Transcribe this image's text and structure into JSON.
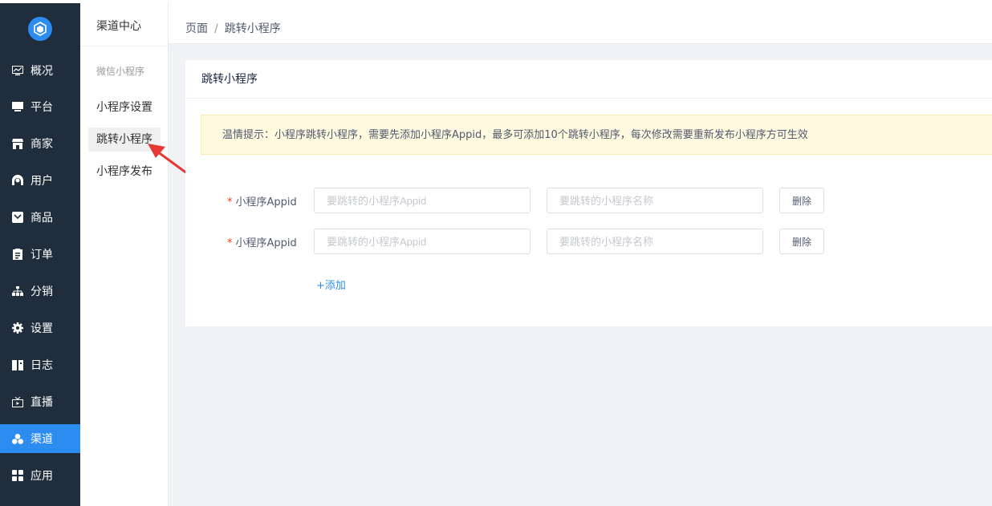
{
  "sidebar": {
    "logo_icon": "box-logo-icon",
    "items": [
      {
        "label": "概况",
        "icon": "chart-icon",
        "active": false
      },
      {
        "label": "平台",
        "icon": "monitor-icon",
        "active": false
      },
      {
        "label": "商家",
        "icon": "store-icon",
        "active": false
      },
      {
        "label": "用户",
        "icon": "user-icon",
        "active": false
      },
      {
        "label": "商品",
        "icon": "goods-icon",
        "active": false
      },
      {
        "label": "订单",
        "icon": "order-icon",
        "active": false
      },
      {
        "label": "分销",
        "icon": "org-tree-icon",
        "active": false
      },
      {
        "label": "设置",
        "icon": "gear-icon",
        "active": false
      },
      {
        "label": "日志",
        "icon": "book-icon",
        "active": false
      },
      {
        "label": "直播",
        "icon": "tv-icon",
        "active": false
      },
      {
        "label": "渠道",
        "icon": "channel-icon",
        "active": true
      },
      {
        "label": "应用",
        "icon": "grid-icon",
        "active": false
      }
    ],
    "accent": "#2d8cf0",
    "background": "#1f2d3d"
  },
  "submenu": {
    "title": "渠道中心",
    "group_label": "微信小程序",
    "items": [
      {
        "label": "小程序设置",
        "active": false
      },
      {
        "label": "跳转小程序",
        "active": true
      },
      {
        "label": "小程序发布",
        "active": false
      }
    ]
  },
  "breadcrumb": {
    "root": "页面",
    "separator": "/",
    "current": "跳转小程序"
  },
  "card": {
    "title": "跳转小程序",
    "notice": "温情提示：小程序跳转小程序，需要先添加小程序Appid，最多可添加10个跳转小程序，每次修改需要重新发布小程序方可生效",
    "rows": [
      {
        "label": "小程序Appid",
        "required_mark": "*",
        "appid_placeholder": "要跳转的小程序Appid",
        "appid_value": "",
        "name_placeholder": "要跳转的小程序名称",
        "name_value": "",
        "delete_label": "删除"
      },
      {
        "label": "小程序Appid",
        "required_mark": "*",
        "appid_placeholder": "要跳转的小程序Appid",
        "appid_value": "",
        "name_placeholder": "要跳转的小程序名称",
        "name_value": "",
        "delete_label": "删除"
      }
    ],
    "add_label": "+添加"
  },
  "colors": {
    "notice_bg": "#fff9e0",
    "link": "#2d8cf0",
    "required": "#ed4014",
    "annotation_arrow": "#e53935"
  }
}
